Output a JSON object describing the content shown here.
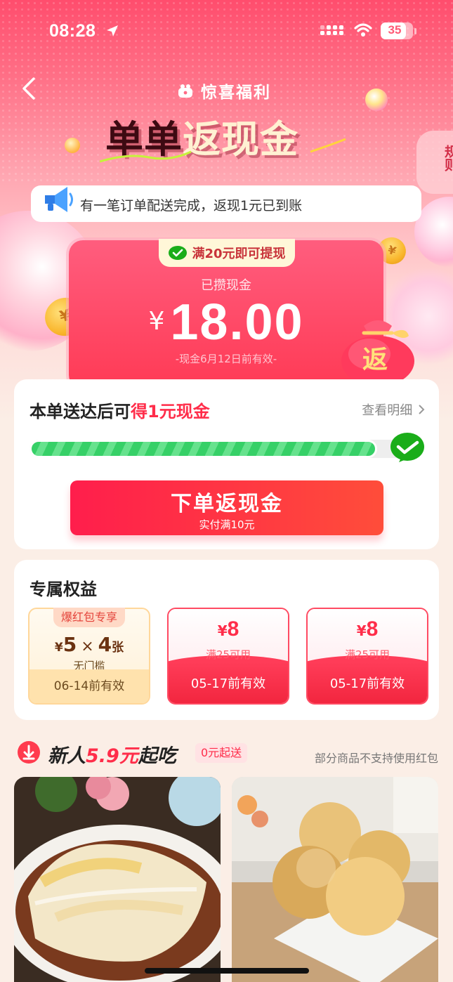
{
  "status_bar": {
    "time": "08:28",
    "battery": "35"
  },
  "header": {
    "brand": "惊喜福利",
    "title_part1": "单单",
    "title_part2": "返现金",
    "rules_label": "规则"
  },
  "notice": {
    "text": "有一笔订单配送完成，返现1元已到账"
  },
  "cash": {
    "tag": "满20元即可提现",
    "label": "已攒现金",
    "currency": "¥",
    "amount": "18.00",
    "expire": "-现金6月12日前有效-",
    "bag_label": "返"
  },
  "order": {
    "title_prefix": "本单送达后可",
    "title_highlight": "得1元现金",
    "detail_link": "查看明细",
    "progress": 0.92,
    "cta_label": "下单返现金",
    "cta_sub": "实付满10元"
  },
  "perks": {
    "title": "专属权益",
    "special": {
      "badge": "爆红包专享",
      "currency": "¥",
      "amount": "5",
      "times": "×",
      "count": "4",
      "unit": "张",
      "condition": "无门槛",
      "expire": "06-14前有效"
    },
    "coupons": [
      {
        "currency": "¥",
        "amount": "8",
        "condition": "满25可用",
        "expire": "05-17前有效"
      },
      {
        "currency": "¥",
        "amount": "8",
        "condition": "满25可用",
        "expire": "05-17前有效"
      }
    ]
  },
  "promo": {
    "title_prefix": "新人",
    "title_highlight": "5.9元",
    "title_suffix": "起吃",
    "chip": "0元起送",
    "note": "部分商品不支持使用红包"
  },
  "colors": {
    "accent": "#ff2d4a",
    "green": "#36d067",
    "gold": "#f9b52b"
  }
}
